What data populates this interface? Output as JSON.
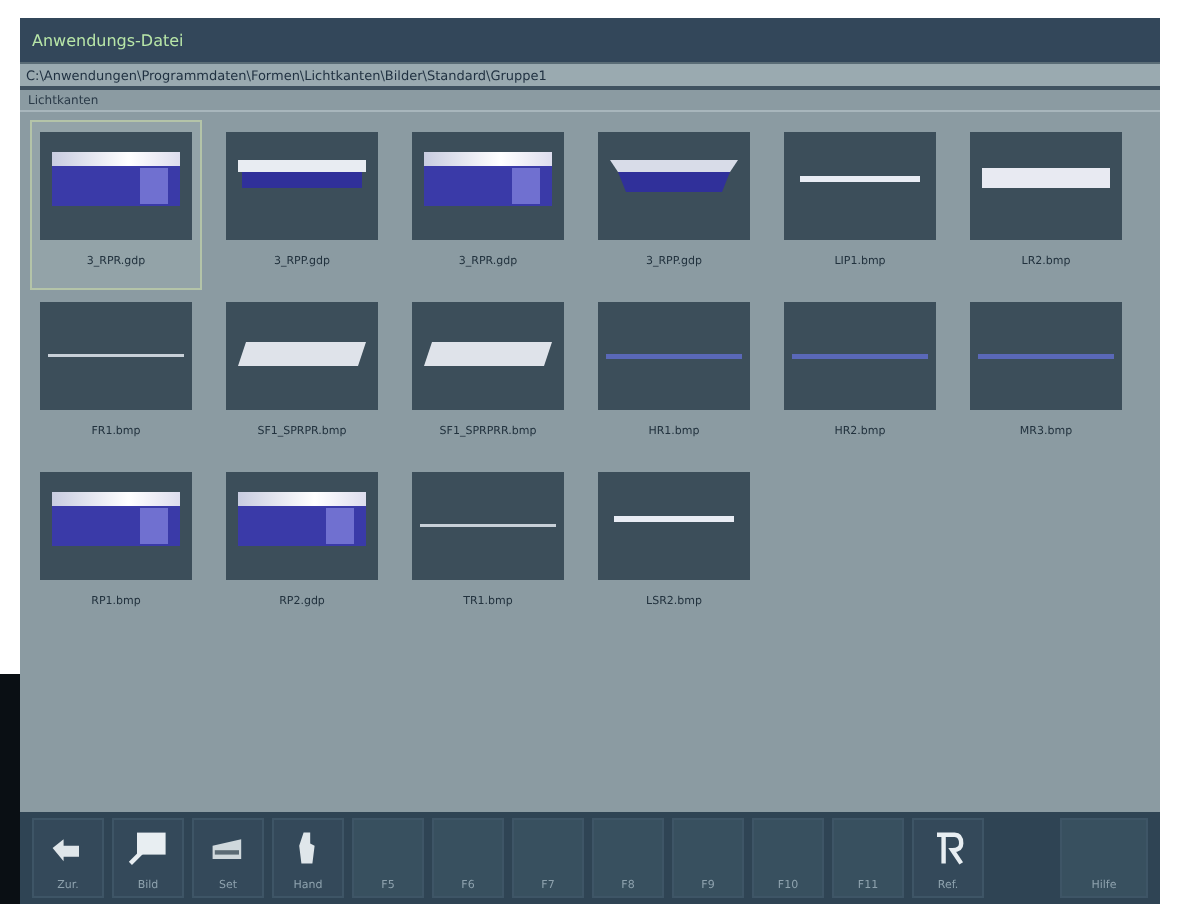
{
  "window": {
    "title": "Anwendungs-Datei"
  },
  "path": "C:\\Anwendungen\\Programmdaten\\Formen\\Lichtkanten\\Bilder\\Standard\\Gruppe1",
  "section": "Lichtkanten",
  "thumbnails": [
    {
      "label": "3_RPR.gdp",
      "kind": "deep",
      "selected": true
    },
    {
      "label": "3_RPP.gdp",
      "kind": "shallow",
      "selected": false
    },
    {
      "label": "3_RPR.gdp",
      "kind": "deep",
      "selected": false
    },
    {
      "label": "3_RPP.gdp",
      "kind": "bowl",
      "selected": false
    },
    {
      "label": "LIP1.bmp",
      "kind": "thin",
      "selected": false
    },
    {
      "label": "LR2.bmp",
      "kind": "wide",
      "selected": false
    },
    {
      "label": "FR1.bmp",
      "kind": "line",
      "selected": false
    },
    {
      "label": "SF1_SPRPR.bmp",
      "kind": "slant",
      "selected": false
    },
    {
      "label": "SF1_SPRPRR.bmp",
      "kind": "slant",
      "selected": false
    },
    {
      "label": "HR1.bmp",
      "kind": "blueline",
      "selected": false
    },
    {
      "label": "HR2.bmp",
      "kind": "blueline",
      "selected": false
    },
    {
      "label": "MR3.bmp",
      "kind": "blueline",
      "selected": false
    },
    {
      "label": "RP1.bmp",
      "kind": "deep",
      "selected": false
    },
    {
      "label": "RP2.gdp",
      "kind": "deep",
      "selected": false
    },
    {
      "label": "TR1.bmp",
      "kind": "line",
      "selected": false
    },
    {
      "label": "LSR2.bmp",
      "kind": "thin",
      "selected": false
    }
  ],
  "toolbar": [
    {
      "label": "Zur.",
      "kind": "back"
    },
    {
      "label": "Bild"
    },
    {
      "label": "Set",
      "kind": "stack"
    },
    {
      "label": "Hand",
      "kind": "hand"
    },
    {
      "label": "F5",
      "kind": "plain"
    },
    {
      "label": "F6",
      "kind": "plain"
    },
    {
      "label": "F7",
      "kind": "plain"
    },
    {
      "label": "F8",
      "kind": "plain"
    },
    {
      "label": "F9",
      "kind": "plain"
    },
    {
      "label": "F10",
      "kind": "plain"
    },
    {
      "label": "F11",
      "kind": "plain"
    },
    {
      "label": "Ref.",
      "kind": "r"
    },
    {
      "label": "Hilfe",
      "kind": "plain"
    }
  ]
}
